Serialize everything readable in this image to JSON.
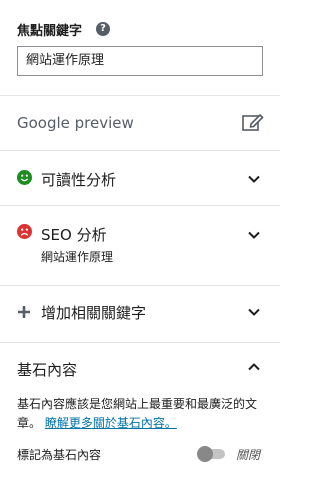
{
  "focus_keyphrase": {
    "label": "焦點關鍵字",
    "help_icon": "question-circle-icon",
    "value": "網站運作原理"
  },
  "google_preview": {
    "label": "Google preview",
    "icon": "edit-icon"
  },
  "readability": {
    "label": "可讀性分析",
    "status_icon": "smiley-good-icon",
    "status_color": "#1e8c1e"
  },
  "seo_analysis": {
    "label": "SEO 分析",
    "keyphrase": "網站運作原理",
    "status_icon": "smiley-bad-icon",
    "status_color": "#dc3232"
  },
  "add_keyphrase": {
    "label": "增加相關關鍵字",
    "icon": "plus-icon"
  },
  "cornerstone": {
    "title": "基石內容",
    "description": "基石內容應該是您網站上最重要和最廣泛的文章。",
    "link_text": "瞭解更多關於基石內容。",
    "toggle_label": "標記為基石內容",
    "toggle_state": "關閉"
  },
  "colors": {
    "link": "#0073aa",
    "divider": "#e2e4e7",
    "text": "#1e1e1e"
  }
}
